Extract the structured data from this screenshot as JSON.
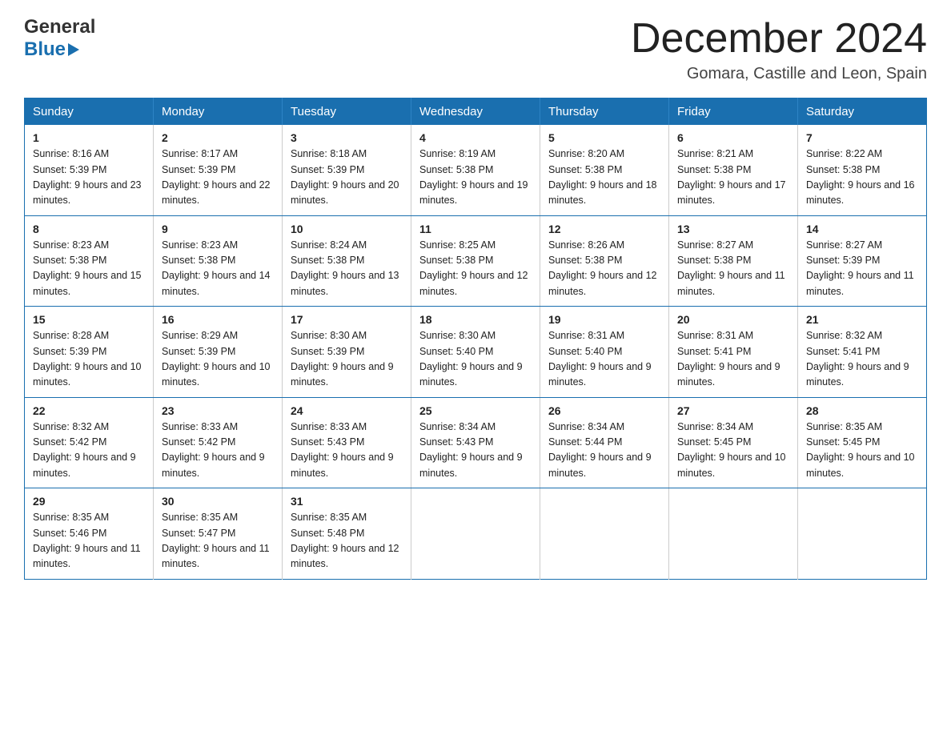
{
  "header": {
    "logo_line1": "General",
    "logo_line2": "Blue",
    "month_title": "December 2024",
    "location": "Gomara, Castille and Leon, Spain"
  },
  "days_of_week": [
    "Sunday",
    "Monday",
    "Tuesday",
    "Wednesday",
    "Thursday",
    "Friday",
    "Saturday"
  ],
  "weeks": [
    [
      {
        "day": "1",
        "sunrise": "8:16 AM",
        "sunset": "5:39 PM",
        "daylight": "9 hours and 23 minutes."
      },
      {
        "day": "2",
        "sunrise": "8:17 AM",
        "sunset": "5:39 PM",
        "daylight": "9 hours and 22 minutes."
      },
      {
        "day": "3",
        "sunrise": "8:18 AM",
        "sunset": "5:39 PM",
        "daylight": "9 hours and 20 minutes."
      },
      {
        "day": "4",
        "sunrise": "8:19 AM",
        "sunset": "5:38 PM",
        "daylight": "9 hours and 19 minutes."
      },
      {
        "day": "5",
        "sunrise": "8:20 AM",
        "sunset": "5:38 PM",
        "daylight": "9 hours and 18 minutes."
      },
      {
        "day": "6",
        "sunrise": "8:21 AM",
        "sunset": "5:38 PM",
        "daylight": "9 hours and 17 minutes."
      },
      {
        "day": "7",
        "sunrise": "8:22 AM",
        "sunset": "5:38 PM",
        "daylight": "9 hours and 16 minutes."
      }
    ],
    [
      {
        "day": "8",
        "sunrise": "8:23 AM",
        "sunset": "5:38 PM",
        "daylight": "9 hours and 15 minutes."
      },
      {
        "day": "9",
        "sunrise": "8:23 AM",
        "sunset": "5:38 PM",
        "daylight": "9 hours and 14 minutes."
      },
      {
        "day": "10",
        "sunrise": "8:24 AM",
        "sunset": "5:38 PM",
        "daylight": "9 hours and 13 minutes."
      },
      {
        "day": "11",
        "sunrise": "8:25 AM",
        "sunset": "5:38 PM",
        "daylight": "9 hours and 12 minutes."
      },
      {
        "day": "12",
        "sunrise": "8:26 AM",
        "sunset": "5:38 PM",
        "daylight": "9 hours and 12 minutes."
      },
      {
        "day": "13",
        "sunrise": "8:27 AM",
        "sunset": "5:38 PM",
        "daylight": "9 hours and 11 minutes."
      },
      {
        "day": "14",
        "sunrise": "8:27 AM",
        "sunset": "5:39 PM",
        "daylight": "9 hours and 11 minutes."
      }
    ],
    [
      {
        "day": "15",
        "sunrise": "8:28 AM",
        "sunset": "5:39 PM",
        "daylight": "9 hours and 10 minutes."
      },
      {
        "day": "16",
        "sunrise": "8:29 AM",
        "sunset": "5:39 PM",
        "daylight": "9 hours and 10 minutes."
      },
      {
        "day": "17",
        "sunrise": "8:30 AM",
        "sunset": "5:39 PM",
        "daylight": "9 hours and 9 minutes."
      },
      {
        "day": "18",
        "sunrise": "8:30 AM",
        "sunset": "5:40 PM",
        "daylight": "9 hours and 9 minutes."
      },
      {
        "day": "19",
        "sunrise": "8:31 AM",
        "sunset": "5:40 PM",
        "daylight": "9 hours and 9 minutes."
      },
      {
        "day": "20",
        "sunrise": "8:31 AM",
        "sunset": "5:41 PM",
        "daylight": "9 hours and 9 minutes."
      },
      {
        "day": "21",
        "sunrise": "8:32 AM",
        "sunset": "5:41 PM",
        "daylight": "9 hours and 9 minutes."
      }
    ],
    [
      {
        "day": "22",
        "sunrise": "8:32 AM",
        "sunset": "5:42 PM",
        "daylight": "9 hours and 9 minutes."
      },
      {
        "day": "23",
        "sunrise": "8:33 AM",
        "sunset": "5:42 PM",
        "daylight": "9 hours and 9 minutes."
      },
      {
        "day": "24",
        "sunrise": "8:33 AM",
        "sunset": "5:43 PM",
        "daylight": "9 hours and 9 minutes."
      },
      {
        "day": "25",
        "sunrise": "8:34 AM",
        "sunset": "5:43 PM",
        "daylight": "9 hours and 9 minutes."
      },
      {
        "day": "26",
        "sunrise": "8:34 AM",
        "sunset": "5:44 PM",
        "daylight": "9 hours and 9 minutes."
      },
      {
        "day": "27",
        "sunrise": "8:34 AM",
        "sunset": "5:45 PM",
        "daylight": "9 hours and 10 minutes."
      },
      {
        "day": "28",
        "sunrise": "8:35 AM",
        "sunset": "5:45 PM",
        "daylight": "9 hours and 10 minutes."
      }
    ],
    [
      {
        "day": "29",
        "sunrise": "8:35 AM",
        "sunset": "5:46 PM",
        "daylight": "9 hours and 11 minutes."
      },
      {
        "day": "30",
        "sunrise": "8:35 AM",
        "sunset": "5:47 PM",
        "daylight": "9 hours and 11 minutes."
      },
      {
        "day": "31",
        "sunrise": "8:35 AM",
        "sunset": "5:48 PM",
        "daylight": "9 hours and 12 minutes."
      },
      null,
      null,
      null,
      null
    ]
  ],
  "labels": {
    "sunrise_prefix": "Sunrise: ",
    "sunset_prefix": "Sunset: ",
    "daylight_prefix": "Daylight: "
  }
}
